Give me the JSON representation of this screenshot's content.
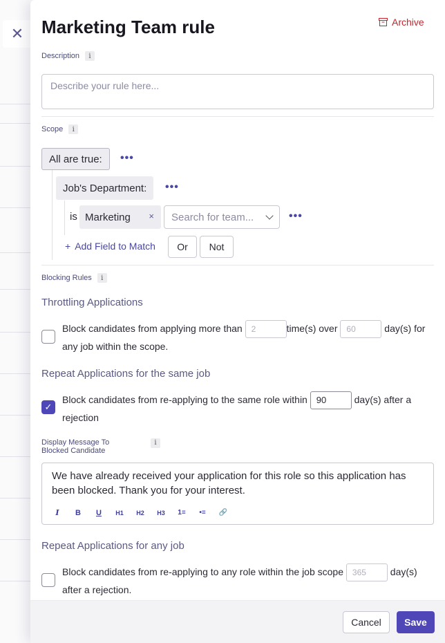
{
  "close": {
    "icon": "close-icon",
    "glyph": "✕"
  },
  "header": {
    "title": "Marketing Team rule",
    "archive_label": "Archive"
  },
  "description": {
    "label": "Description",
    "placeholder": "Describe your rule here...",
    "info_glyph": "i"
  },
  "scope": {
    "label": "Scope",
    "info_glyph": "i",
    "group_label": "All are true:",
    "field_label": "Job's Department:",
    "operator": "is",
    "selected_value": "Marketing",
    "remove_glyph": "×",
    "search_placeholder": "Search for team...",
    "more_glyph": "•••",
    "add_field_label": "Add Field to Match",
    "add_field_plus": "+",
    "or_label": "Or",
    "not_label": "Not"
  },
  "blocking": {
    "label": "Blocking Rules",
    "info_glyph": "i",
    "throttling": {
      "heading": "Throttling Applications",
      "checked": false,
      "text_1": "Block candidates from applying more than",
      "count_placeholder": "2",
      "text_2": "time(s) over",
      "days_placeholder": "60",
      "text_3": "day(s) for any job within the scope."
    },
    "repeat_same": {
      "heading": "Repeat Applications for the same job",
      "checked": true,
      "check_glyph": "✓",
      "text_1": "Block candidates from re-applying to the same role within",
      "days_value": "90",
      "text_2": "day(s) after a rejection"
    },
    "message": {
      "label": "Display Message To Blocked Candidate",
      "info_glyph": "i",
      "text": "We have already received your application for this role so this application has been blocked. Thank you for your interest.",
      "toolbar": [
        {
          "name": "italic-button",
          "glyph": "I"
        },
        {
          "name": "bold-button",
          "glyph": "B"
        },
        {
          "name": "underline-button",
          "glyph": "U"
        },
        {
          "name": "h1-button",
          "glyph": "H1"
        },
        {
          "name": "h2-button",
          "glyph": "H2"
        },
        {
          "name": "h3-button",
          "glyph": "H3"
        },
        {
          "name": "ordered-list-button",
          "glyph": "1≡"
        },
        {
          "name": "bullet-list-button",
          "glyph": "•≡"
        },
        {
          "name": "link-button",
          "glyph": "🔗"
        }
      ]
    },
    "repeat_any": {
      "heading": "Repeat Applications for any job",
      "checked": false,
      "text_1": "Block candidates from re-applying to any role within the job scope",
      "days_placeholder": "365",
      "text_2": "day(s) after a rejection."
    }
  },
  "footer": {
    "cancel_label": "Cancel",
    "save_label": "Save"
  },
  "colors": {
    "accent": "#4f47b8",
    "danger": "#c4262e"
  }
}
